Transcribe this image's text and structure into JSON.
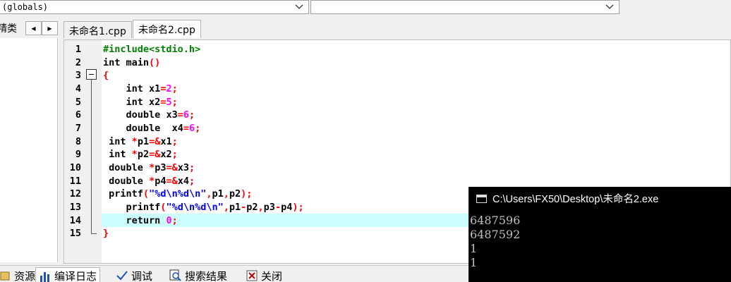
{
  "toolbar": {
    "scope_combo": "(globals)",
    "member_combo": ""
  },
  "tabs": {
    "class_tab_label": "精类",
    "file_tabs": [
      "未命名1.cpp",
      "未命名2.cpp"
    ],
    "active": 1
  },
  "editor": {
    "highlighted_line": 14,
    "line_numbers": [
      "1",
      "2",
      "3",
      "4",
      "5",
      "6",
      "7",
      "8",
      "9",
      "10",
      "11",
      "12",
      "13",
      "14",
      "15"
    ]
  },
  "console": {
    "title": "C:\\Users\\FX50\\Desktop\\未命名2.exe",
    "output": [
      "6487596",
      "6487592",
      "1",
      "1"
    ]
  },
  "bottom_tabs": {
    "resources": "资源",
    "compile_log": "编译日志",
    "debug": "调试",
    "search_results": "搜索结果",
    "close": "关闭"
  },
  "colors": {
    "preprocessor": "#008000",
    "number": "#ff00ff",
    "operator": "#ff0000",
    "string": "#0000ff",
    "current_line": "#ccffff",
    "console_bg": "#000000",
    "console_text": "#c0c0c0"
  }
}
